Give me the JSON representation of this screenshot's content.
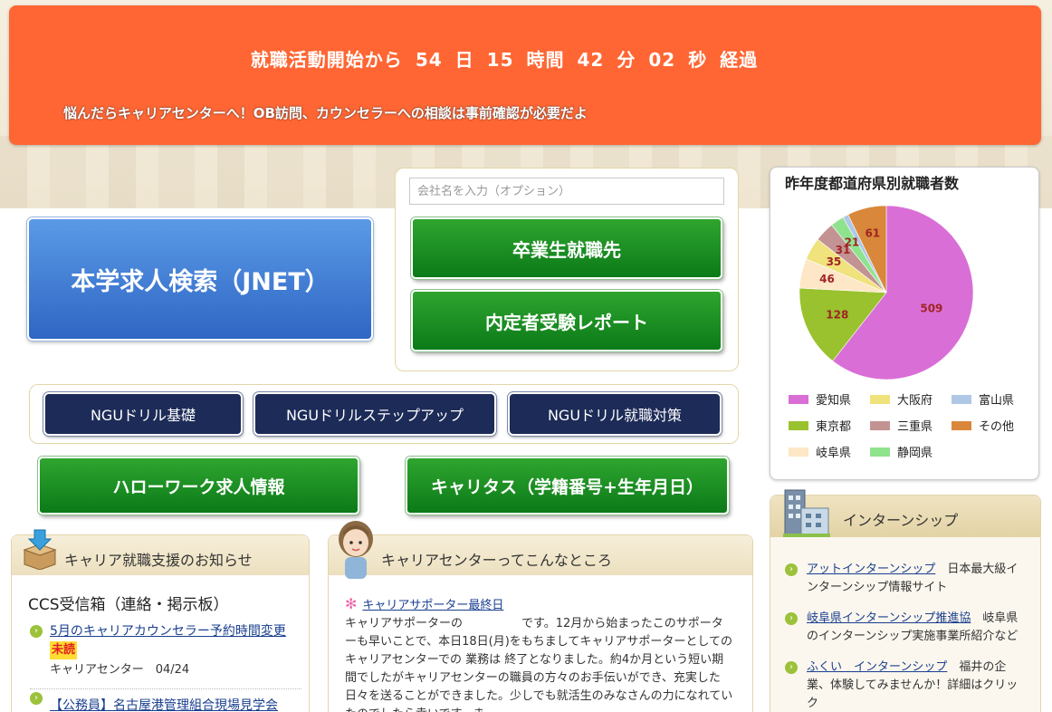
{
  "banner": {
    "countdown": {
      "prefix": "就職活動開始から",
      "days": "54",
      "days_unit": "日",
      "hours": "15",
      "hours_unit": "時間",
      "minutes": "42",
      "minutes_unit": "分",
      "seconds": "02",
      "seconds_unit": "秒",
      "suffix": "経過"
    },
    "tip": "悩んだらキャリアセンターへ！OB訪問、カウンセラーへの相談は事前確認が必要だよ"
  },
  "search": {
    "jnet_label": "本学求人検索（JNET）",
    "company_placeholder": "会社名を入力（オプション）",
    "graduates_label": "卒業生就職先",
    "report_label": "内定者受験レポート"
  },
  "drills": {
    "basic": "NGUドリル基礎",
    "stepup": "NGUドリルステップアップ",
    "job": "NGUドリル就職対策"
  },
  "links": {
    "hellowork": "ハローワーク求人情報",
    "caritas": "キャリタス（学籍番号+生年月日）"
  },
  "chart_data": {
    "type": "pie",
    "title": "昨年度都道府県別就職者数",
    "slices": [
      {
        "label": "愛知県",
        "value": 509,
        "color": "#d96fd6"
      },
      {
        "label": "東京都",
        "value": 128,
        "color": "#99c22e"
      },
      {
        "label": "岐阜県",
        "value": 46,
        "color": "#fde7c6"
      },
      {
        "label": "大阪府",
        "value": 35,
        "color": "#f0e27c"
      },
      {
        "label": "三重県",
        "value": 31,
        "color": "#c39393"
      },
      {
        "label": "静岡県",
        "value": 21,
        "color": "#8fe38f"
      },
      {
        "label": "富山県",
        "value": 9,
        "color": "#aec8e6"
      },
      {
        "label": "その他",
        "value": 61,
        "color": "#d9873a"
      }
    ],
    "shown_labels": [
      "509",
      "128",
      "46",
      "35",
      "31",
      "21",
      "61"
    ]
  },
  "internship": {
    "title": "インターンシップ",
    "items": [
      {
        "link": "アットインターンシップ",
        "desc": "日本最大級インターンシップ情報サイト"
      },
      {
        "link": "岐阜県インターンシップ推進協",
        "desc": "岐阜県のインターンシップ実施事業所紹介など"
      },
      {
        "link": "ふくい　インターンシップ",
        "desc": "福井の企業、体験してみませんか！詳細はクリック"
      }
    ]
  },
  "news": {
    "title": "キャリア就職支援のお知らせ",
    "ccs_title": "CCS受信箱（連絡・掲示板）",
    "items": [
      {
        "title": "5月のキャリアカウンセラー予約時間変更",
        "badge": "未読",
        "meta": "キャリアセンター　04/24"
      },
      {
        "title": "【公務員】名古屋港管理組合現場見学会",
        "badge": "",
        "meta": ""
      }
    ]
  },
  "center": {
    "title": "キャリアセンターってこんなところ",
    "post_title": "キャリアサポーター最終日",
    "post_body": "キャリアサポーターの　　　　　です。12月から始まったこのサポーターも早いことで、本日18日(月)をもちましてキャリアサポーターとしての キャリアセンターでの 業務は 終了となりました。約4か月という短い期間でしたがキャリアセンターの職員の方々のお手伝いができ、充実した日々を送ることができました。少しでも就活生のみなさんの力になれていたのでしたら幸いです。ま"
  }
}
